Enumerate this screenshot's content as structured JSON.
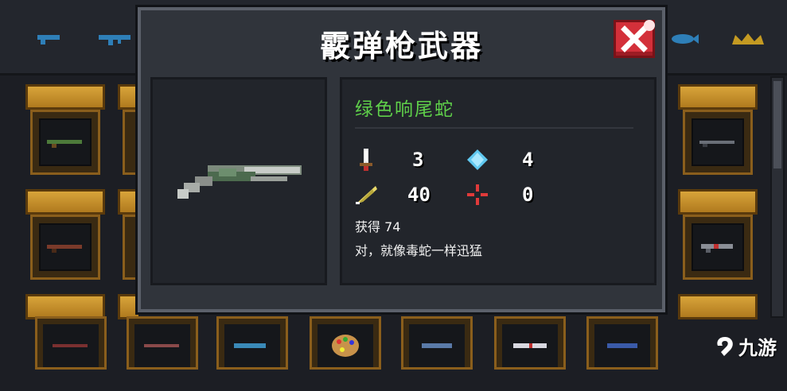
{
  "dialog": {
    "title": "霰弹枪武器",
    "close_label": "✕"
  },
  "weapon": {
    "name": "绿色响尾蛇",
    "stats": {
      "damage": "3",
      "energy_cost": "4",
      "crit_chance": "40",
      "inaccuracy": "0"
    },
    "obtain_text": "获得 74",
    "description": "对，就像毒蛇一样迅猛"
  },
  "watermark": {
    "text": "九游"
  },
  "colors": {
    "name_green": "#5fd04a",
    "close_red": "#d3303a",
    "shelf_gold": "#d8a43a"
  },
  "icons": {
    "damage": "sword-icon",
    "energy": "diamond-icon",
    "crit": "feather-icon",
    "inaccuracy": "crosshair-icon"
  }
}
